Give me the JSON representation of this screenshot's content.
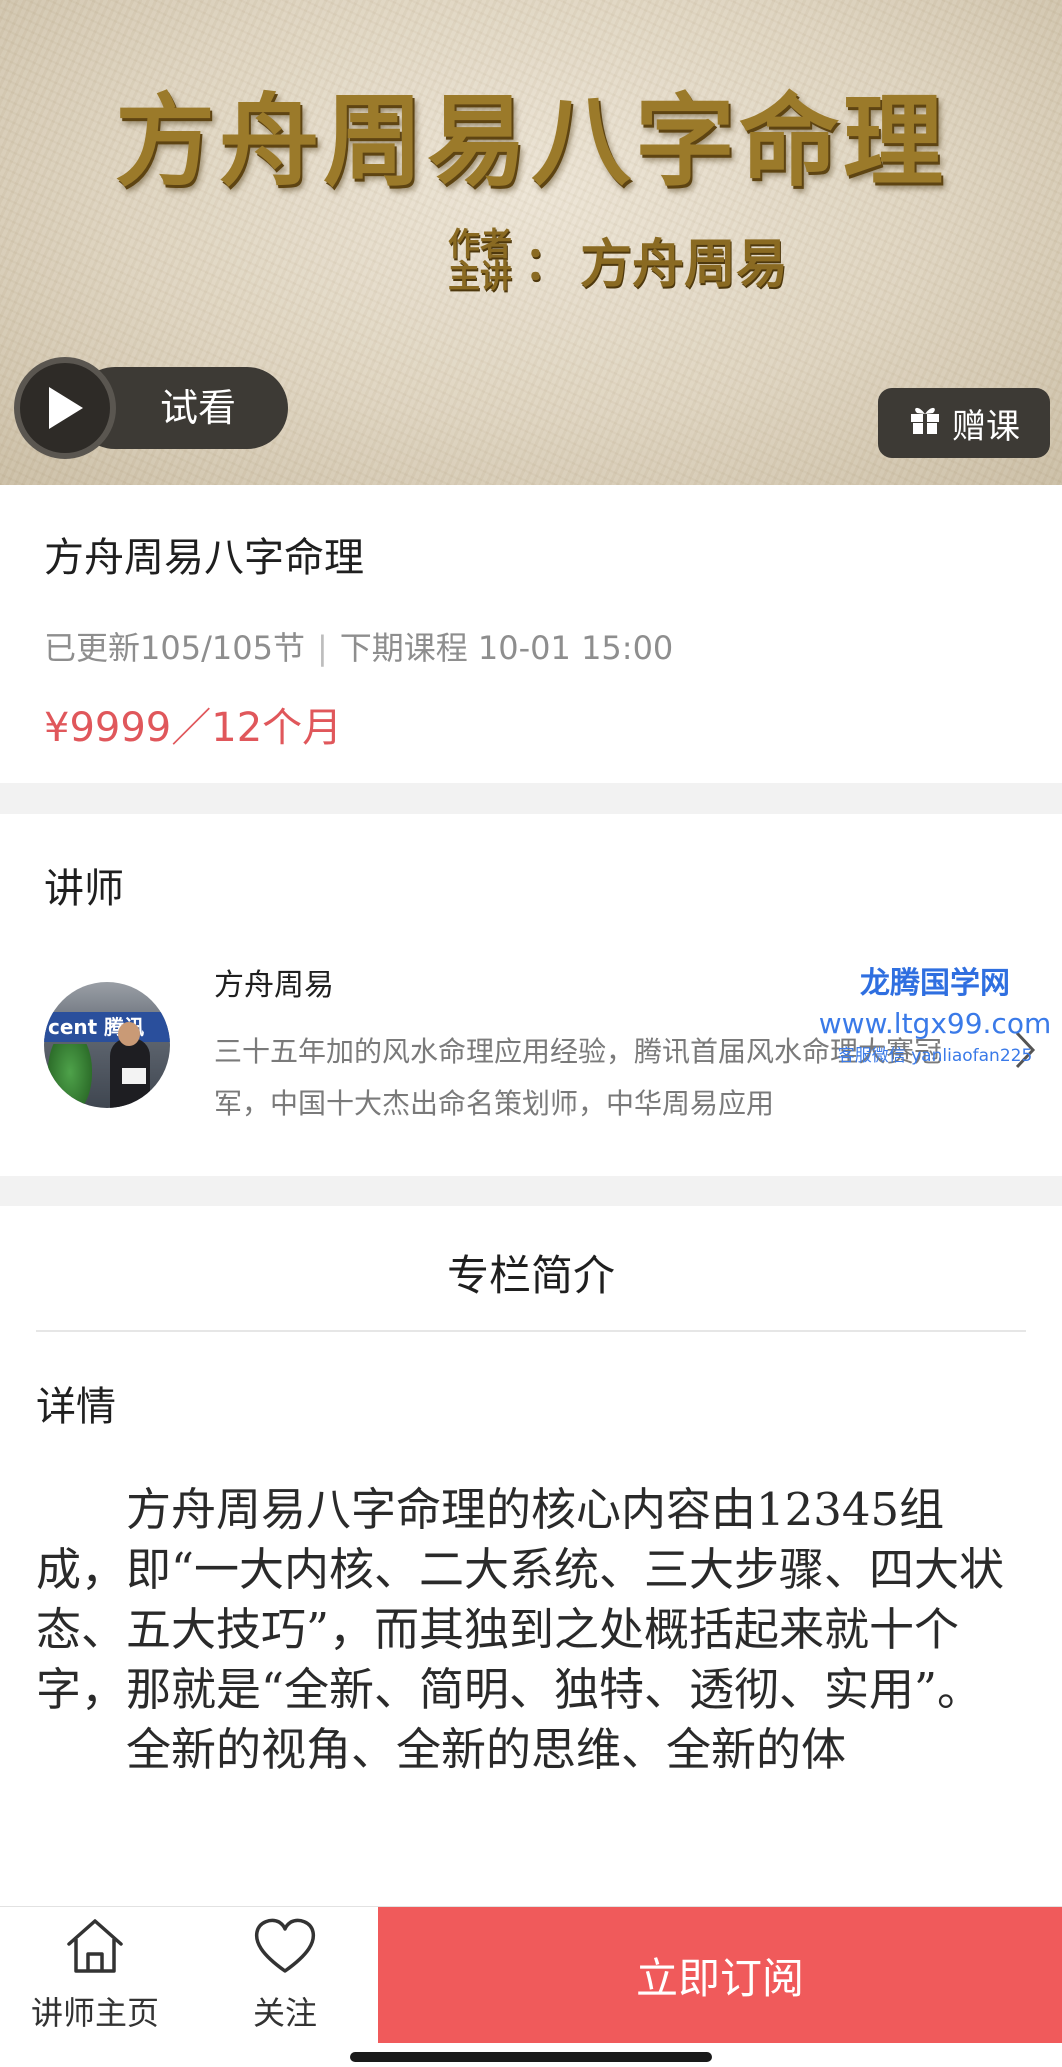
{
  "hero": {
    "title": "方舟周易八字命理",
    "author_role_1": "作者",
    "author_role_2": "主讲",
    "author_colon": "：",
    "author_name": "方舟周易",
    "trial_label": "试看",
    "gift_label": "赠课"
  },
  "course": {
    "title": "方舟周易八字命理",
    "updated": "已更新105/105节",
    "separator": "|",
    "next_session": "下期课程 10-01 15:00",
    "price": "¥9999／12个月"
  },
  "teacher": {
    "heading": "讲师",
    "avatar_sign_text": "cent 腾讯",
    "name": "方舟周易",
    "bio": "三十五年加的风水命理应用经验，腾讯首届风水命理大赛冠军，中国十大杰出命名策划师，中华周易应用"
  },
  "watermark": {
    "line1": "龙腾国学网",
    "line2": "www.ltgx99.com",
    "line3": "客服微信 yanliaofan225"
  },
  "intro": {
    "heading": "专栏简介",
    "detail_label": "详情",
    "paragraph_1": "方舟周易八字命理的核心内容由12345组成，即“一大内核、二大系统、三大步骤、四大状态、五大技巧”，而其独到之处概括起来就十个字，那就是“全新、简明、独特、透彻、实用”。",
    "paragraph_2": "全新的视角、全新的思维、全新的体"
  },
  "bottom_bar": {
    "home_label": "讲师主页",
    "follow_label": "关注",
    "subscribe_label": "立即订阅"
  },
  "colors": {
    "accent_red": "#f05a5b",
    "price_red": "#e0575b",
    "watermark_blue": "#2f6fe0"
  },
  "icons": {
    "trial": "play-icon",
    "gift": "gift-icon",
    "teacher_more": "chevron-right-icon",
    "home": "home-icon",
    "follow": "heart-icon"
  }
}
